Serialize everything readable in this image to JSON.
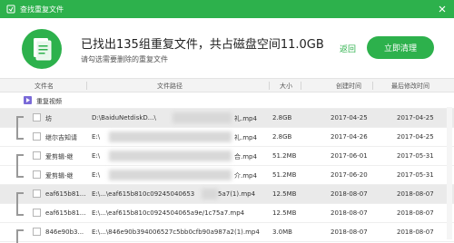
{
  "window": {
    "title": "查找重复文件"
  },
  "header": {
    "summary": "已找出135组重复文件，共占磁盘空间11.0GB",
    "subtext": "请勾选需要删除的重复文件",
    "back_label": "返回",
    "clean_label": "立即清理"
  },
  "columns": {
    "name": "文件名",
    "path": "文件路径",
    "size": "大小",
    "created": "创建时间",
    "modified": "最后修改时间"
  },
  "group": {
    "label": "重复视频"
  },
  "rows": [
    {
      "name": "坊",
      "path": "D:\\BaiduNetdiskD...\\",
      "path_tail": "礼.mp4",
      "size": "2.8GB",
      "created": "2017-04-25",
      "modified": "2017-04-25"
    },
    {
      "name": "继尔吉知请",
      "path": "E:\\",
      "path_tail": "礼.mp4",
      "size": "2.8GB",
      "created": "2017-04-26",
      "modified": "2017-04-25"
    },
    {
      "name": "爱剪辑-继",
      "path": "E:\\",
      "path_tail": "合.mp4",
      "size": "51.2MB",
      "created": "2017-06-01",
      "modified": "2017-05-31"
    },
    {
      "name": "爱剪辑-继",
      "path": "E:\\",
      "path_tail": "介.mp4",
      "size": "51.2MB",
      "created": "2017-06-20",
      "modified": "2017-05-31"
    },
    {
      "name": "eaf615b81...",
      "path": "E:\\...\\eaf615b810c09245040653",
      "path_tail": "5a7(1).mp4",
      "size": "12.5MB",
      "created": "2018-08-07",
      "modified": "2018-08-07"
    },
    {
      "name": "eaf615b81...",
      "path": "E:\\...\\eaf615b810c0924504065a9e/1c75a7.mp4",
      "path_tail": "",
      "size": "12.5MB",
      "created": "2018-08-07",
      "modified": "2018-08-07"
    },
    {
      "name": "846e90b3...",
      "path": "E:\\...\\846e90b394006527c5bb0cfb90a987a2(1).mp4",
      "path_tail": "",
      "size": "3.0MB",
      "created": "2018-08-07",
      "modified": "2018-08-07"
    }
  ]
}
